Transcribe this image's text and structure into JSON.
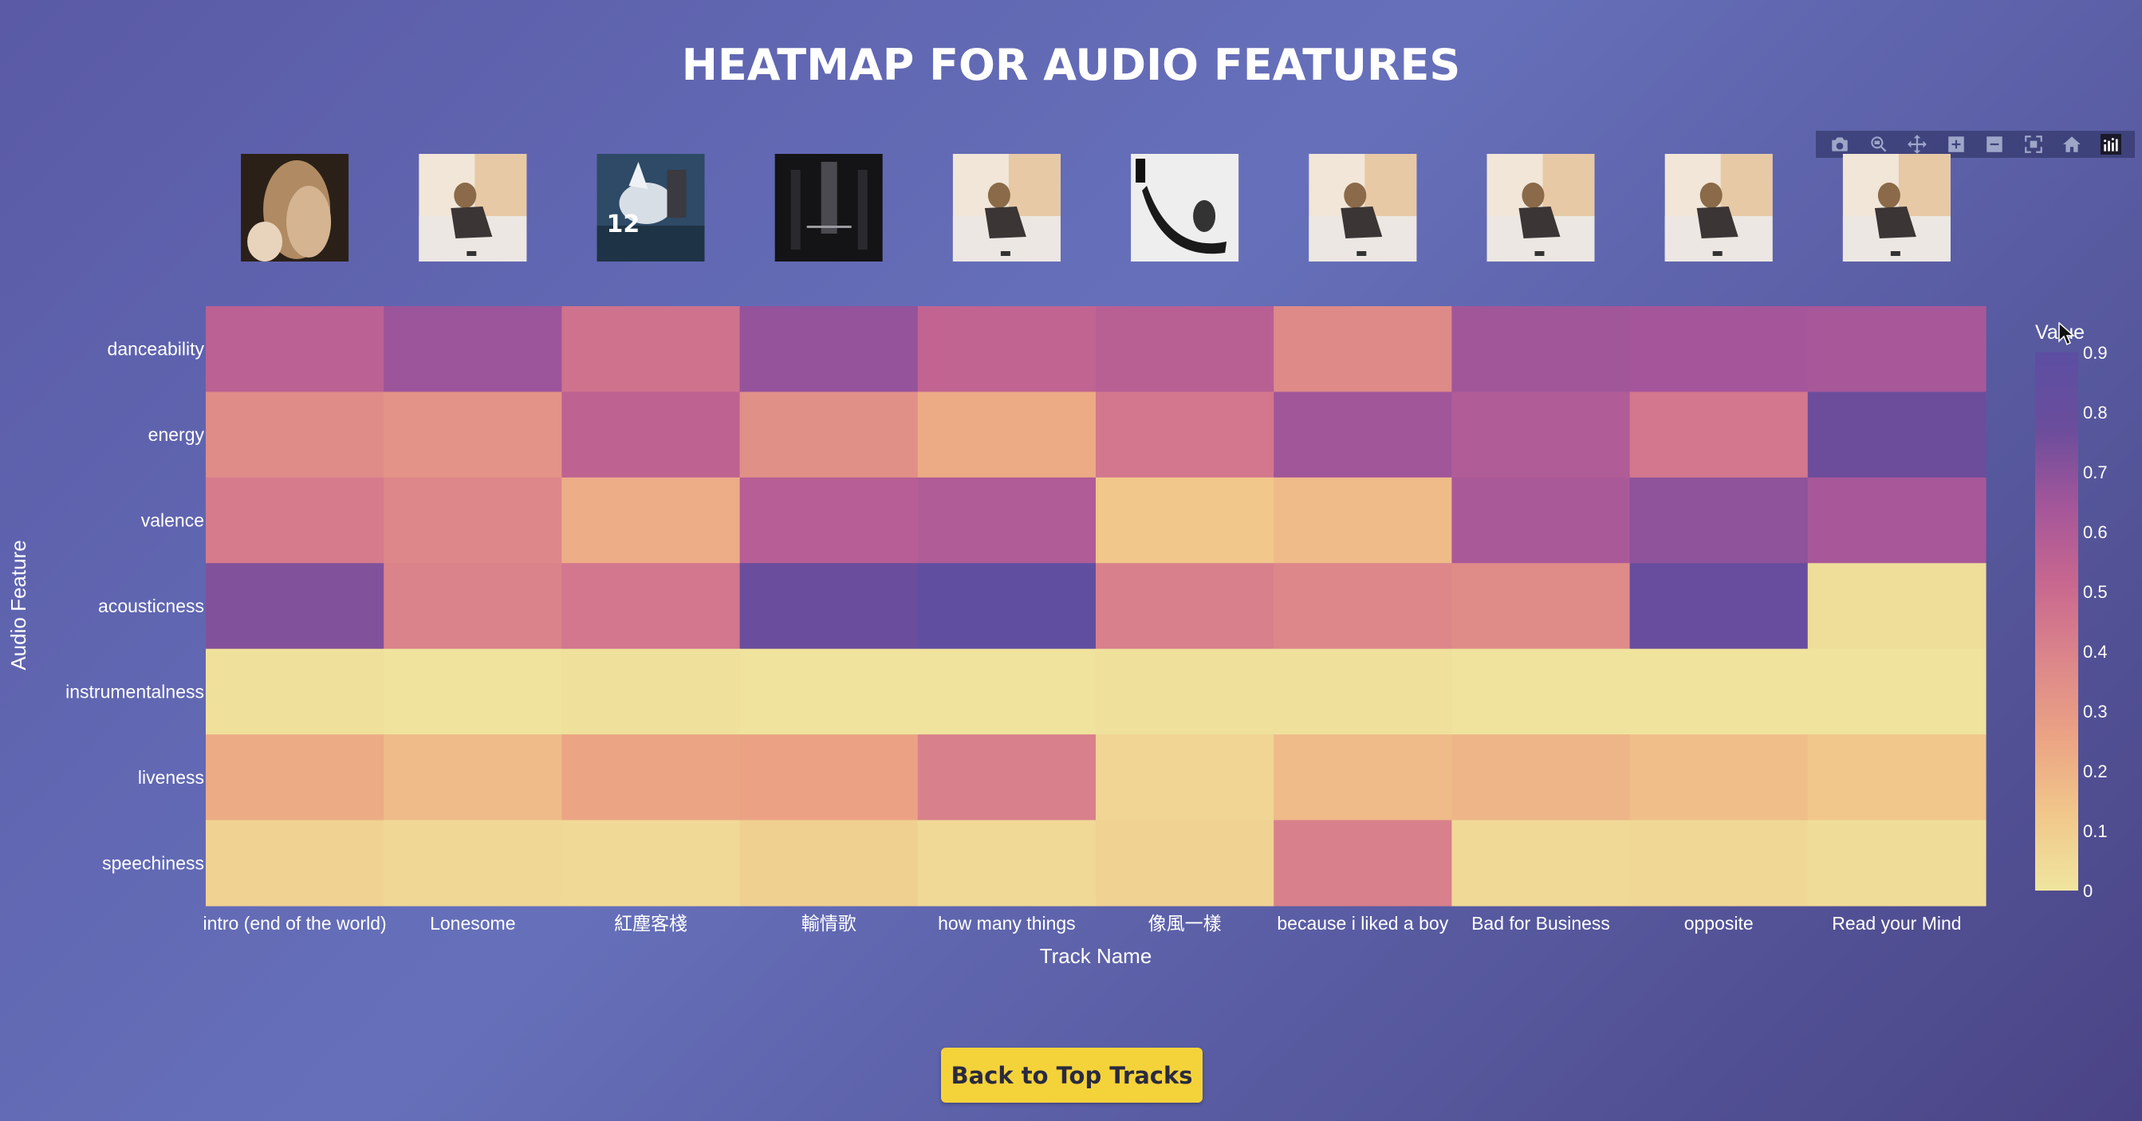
{
  "page": {
    "title": "HEATMAP FOR AUDIO FEATURES"
  },
  "back_button": {
    "label": "Back to Top Tracks"
  },
  "modebar": {
    "icons": [
      "camera-icon",
      "zoom-icon",
      "pan-icon",
      "zoom-in-icon",
      "zoom-out-icon",
      "autoscale-icon",
      "reset-axes-icon",
      "plotly-logo-icon"
    ]
  },
  "albums": [
    {
      "track": "intro (end of the world)",
      "style": "hair"
    },
    {
      "track": "Lonesome",
      "style": "bed"
    },
    {
      "track": "紅塵客棧",
      "style": "horse"
    },
    {
      "track": "輸情歌",
      "style": "dark"
    },
    {
      "track": "how many things",
      "style": "bed"
    },
    {
      "track": "像風一樣",
      "style": "ink"
    },
    {
      "track": "because i liked a boy",
      "style": "bed"
    },
    {
      "track": "Bad for Business",
      "style": "bed"
    },
    {
      "track": "opposite",
      "style": "bed"
    },
    {
      "track": "Read your Mind",
      "style": "bed"
    }
  ],
  "chart_data": {
    "type": "heatmap",
    "title": "HEATMAP FOR AUDIO FEATURES",
    "xlabel": "Track Name",
    "ylabel": "Audio Feature",
    "colorbar_title": "Value",
    "colorbar_ticks": [
      "0",
      "0.1",
      "0.2",
      "0.3",
      "0.4",
      "0.5",
      "0.6",
      "0.7",
      "0.8",
      "0.9"
    ],
    "zmin": 0,
    "zmax": 0.9,
    "colorscale": [
      "#efe59f",
      "#f1c78b",
      "#eba384",
      "#dc868a",
      "#c8678f",
      "#a4569a",
      "#6b4d9c",
      "#5c4ea3"
    ],
    "x": [
      "intro (end of the world)",
      "Lonesome",
      "紅塵客棧",
      "輸情歌",
      "how many things",
      "像風一樣",
      "because i liked a boy",
      "Bad for Business",
      "opposite",
      "Read your Mind"
    ],
    "y": [
      "danceability",
      "energy",
      "valence",
      "acousticness",
      "instrumentalness",
      "liveness",
      "speechiness"
    ],
    "z": [
      [
        0.56,
        0.66,
        0.47,
        0.68,
        0.54,
        0.57,
        0.37,
        0.65,
        0.64,
        0.63
      ],
      [
        0.36,
        0.33,
        0.55,
        0.34,
        0.23,
        0.45,
        0.65,
        0.6,
        0.45,
        0.77
      ],
      [
        0.43,
        0.38,
        0.22,
        0.58,
        0.6,
        0.13,
        0.17,
        0.62,
        0.69,
        0.63
      ],
      [
        0.72,
        0.4,
        0.45,
        0.78,
        0.87,
        0.41,
        0.38,
        0.36,
        0.8,
        0.03
      ],
      [
        0.02,
        0.01,
        0.02,
        0.01,
        0.01,
        0.02,
        0.02,
        0.01,
        0.01,
        0.01
      ],
      [
        0.23,
        0.17,
        0.25,
        0.26,
        0.41,
        0.07,
        0.17,
        0.19,
        0.16,
        0.13
      ],
      [
        0.08,
        0.06,
        0.05,
        0.09,
        0.05,
        0.08,
        0.41,
        0.05,
        0.06,
        0.04
      ]
    ]
  }
}
